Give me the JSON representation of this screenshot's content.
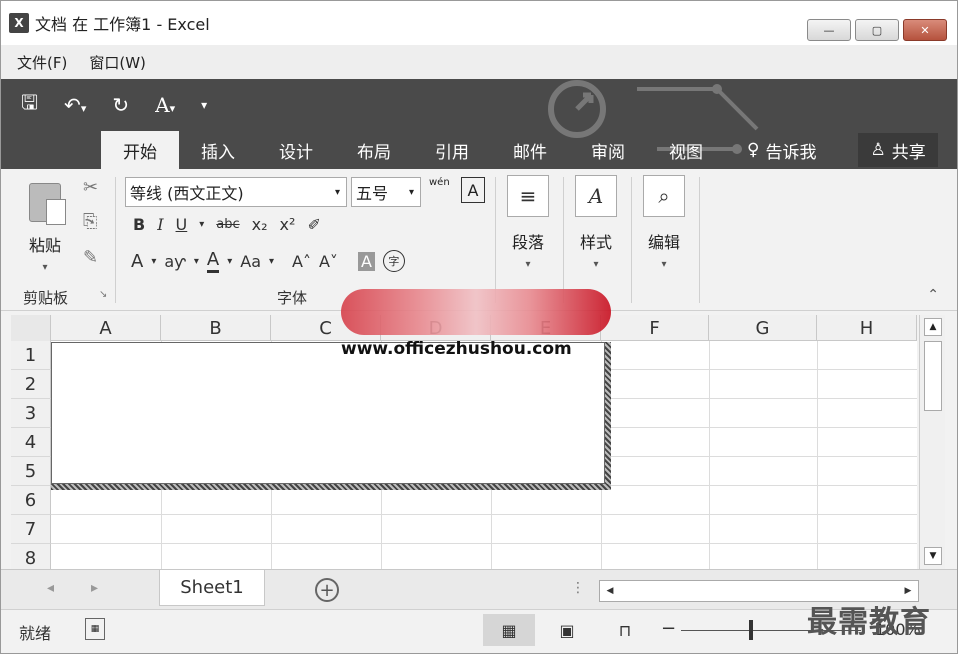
{
  "window": {
    "title": "文档 在 工作簿1 - Excel",
    "app_icon": "X",
    "buttons": {
      "minimize": "—",
      "restore": "▢",
      "close": "✕"
    }
  },
  "menubar": {
    "items": [
      "文件(F)",
      "窗口(W)"
    ]
  },
  "qat": {
    "icons": [
      "save-icon",
      "undo-icon",
      "redo-icon",
      "font-style-icon",
      "customize-icon"
    ],
    "save": "🖫",
    "undo": "↶",
    "undo_drop": "▾",
    "redo": "↻",
    "font_style": "A",
    "font_drop": "▾",
    "customize": "▾"
  },
  "tabs": {
    "items": [
      "开始",
      "插入",
      "设计",
      "布局",
      "引用",
      "邮件",
      "审阅",
      "视图"
    ],
    "active": "开始",
    "tell_me": "告诉我",
    "tell_icon": "♀",
    "share": "共享",
    "share_icon": "♙"
  },
  "ribbon": {
    "clipboard": {
      "paste": "粘贴",
      "paste_drop": "▾",
      "label": "剪贴板",
      "launcher": "↘",
      "cut": "✂",
      "copy": "⎘",
      "format_painter": "✎"
    },
    "font": {
      "name": "等线 (西文正文)",
      "size": "五号",
      "drop": "▾",
      "phonetic": "wén",
      "border_char": "A",
      "bold": "B",
      "italic": "I",
      "underline": "U",
      "under_drop": "▾",
      "strike": "abc",
      "sub": "x₂",
      "sup": "x²",
      "clear": "✐",
      "effects": "A",
      "effects_drop": "▾",
      "highlight": "aƴ",
      "highlight_drop": "▾",
      "color": "A",
      "color_drop": "▾",
      "case": "Aa",
      "case_drop": "▾",
      "grow": "A˄",
      "shrink": "A˅",
      "shading": "A",
      "enclose": "字",
      "label": "字体"
    },
    "paragraph": {
      "label": "段落",
      "icon": "≡",
      "drop": "▾"
    },
    "styles": {
      "label": "样式",
      "icon": "A",
      "drop": "▾"
    },
    "editing": {
      "label": "编辑",
      "icon": "⌕",
      "drop": "▾"
    },
    "collapse": "⌃"
  },
  "watermark": {
    "url": "www.officezhushou.com",
    "logo": "最需教育"
  },
  "sheet": {
    "columns": [
      "A",
      "B",
      "C",
      "D",
      "E",
      "F",
      "G",
      "H"
    ],
    "rows": [
      "1",
      "2",
      "3",
      "4",
      "5",
      "6",
      "7",
      "8"
    ]
  },
  "scroll": {
    "up": "▲",
    "down": "▼",
    "left": "◀",
    "right": "▶"
  },
  "sheet_tabs": {
    "tabs": [
      "Sheet1"
    ],
    "add": "+",
    "prev": "◂",
    "next": "▸",
    "more": "⋮"
  },
  "status": {
    "ready": "就绪",
    "macro": "▦",
    "views": {
      "normal": "▦",
      "page_layout": "▣",
      "page_break": "⊓"
    },
    "zoom_minus": "−",
    "zoom": "100%"
  }
}
